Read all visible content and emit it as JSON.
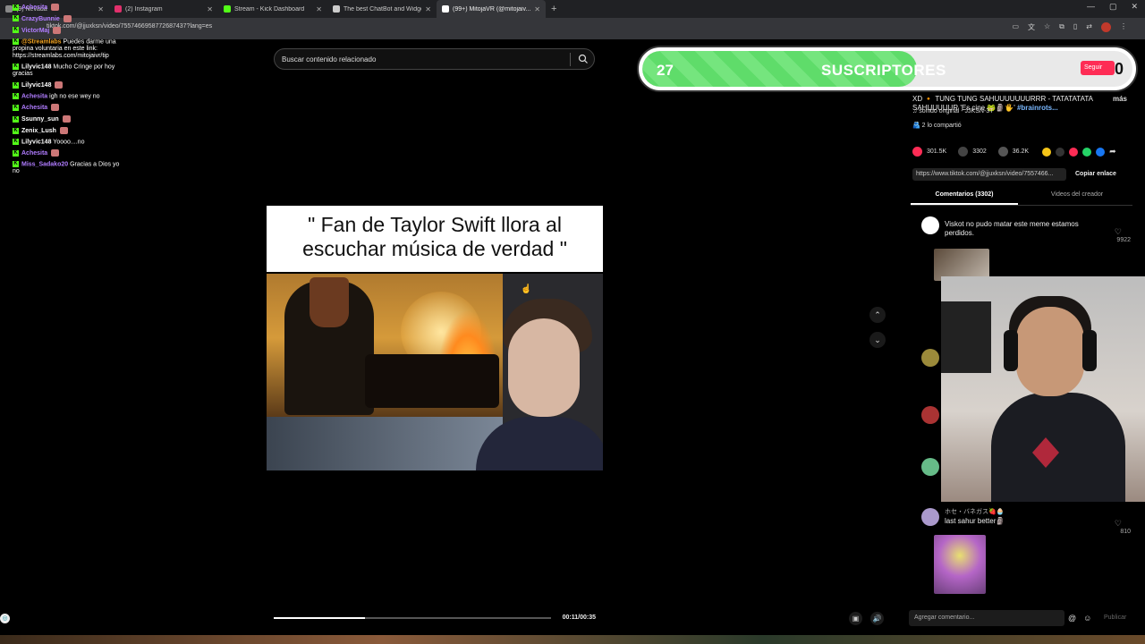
{
  "browser": {
    "tabs": [
      {
        "label": "(9) Nevada",
        "color": "#888"
      },
      {
        "label": "(2) Instagram",
        "color": "#e1306c"
      },
      {
        "label": "Stream - Kick Dashboard",
        "color": "#53fc18"
      },
      {
        "label": "The best ChatBot and Widgets",
        "color": "#ccc"
      },
      {
        "label": "(99+) MitojaVR (@mitojaiv...",
        "color": "#fff"
      }
    ],
    "url": "tiktok.com/@jjuxksn/video/7557466958772687437?lang=es"
  },
  "chat": {
    "messages": [
      {
        "user": "Achesita",
        "text": "",
        "color": "#b07cff"
      },
      {
        "user": "CrazyBunnie",
        "text": "",
        "color": "#b07cff"
      },
      {
        "user": "VictorMaj",
        "text": "",
        "color": "#b07cff"
      },
      {
        "user": "@Streamlabs",
        "text": "Puedes darme una propina voluntaria en este link: https://streamlabs.com/mitojaivr/tip",
        "color": "#f5a623"
      },
      {
        "user": "Lilyvic148",
        "text": "Mucho Cringe por hoy gracias",
        "color": "#fff"
      },
      {
        "user": "Lilyvic148",
        "text": "",
        "color": "#fff"
      },
      {
        "user": "Achesita",
        "text": "igh no ese wey no",
        "color": "#b07cff"
      },
      {
        "user": "Achesita",
        "text": "",
        "color": "#b07cff"
      },
      {
        "user": "Ssunny_sun",
        "text": "",
        "color": "#fff"
      },
      {
        "user": "Zenix_Lush",
        "text": "",
        "color": "#fff"
      },
      {
        "user": "Lilyvic148",
        "text": "Yoooo....no",
        "color": "#fff"
      },
      {
        "user": "Achesita",
        "text": "",
        "color": "#b07cff"
      },
      {
        "user": "Miss_Sadako20",
        "text": "Gracias a Dios yo no",
        "color": "#b07cff"
      }
    ]
  },
  "video": {
    "search_placeholder": "Buscar contenido relacionado",
    "caption": "\" Fan de Taylor Swift llora al escuchar música de verdad \"",
    "time": "00:11/00:35",
    "progress": 0.33
  },
  "subscribers": {
    "current": "27",
    "label": "SUSCRIPTORES",
    "goal": "50",
    "fill": 0.56
  },
  "follow_label": "Seguir",
  "details": {
    "description": "XD 🔸 TUNG TUNG SAHUUUUUUURRR - TATATATATA SAHUUUUUR 'Es cine 🐸🗿🖐' ",
    "hashtag": "#brainrots...",
    "more": "más",
    "sound": "♫ sonido original - JJKSN-3T",
    "shared": "2 lo compartió",
    "likes": "301.5K",
    "comments_count": "3302",
    "saves": "36.2K",
    "link": "https://www.tiktok.com/@jjuxksn/video/7557466...",
    "copy_label": "Copiar enlace",
    "tab_comments": "Comentarios (3302)",
    "tab_creator": "Videos del creador"
  },
  "comments": [
    {
      "name": "",
      "text": "Viskot no pudo matar este meme estamos perdidos.",
      "likes": "9922"
    },
    {
      "name": "ホセ・バネガス🍓🧁",
      "text": "last sahur better🗿",
      "likes": "810"
    }
  ],
  "add_comment": {
    "placeholder": "Agregar comentario...",
    "publish": "Publicar"
  }
}
